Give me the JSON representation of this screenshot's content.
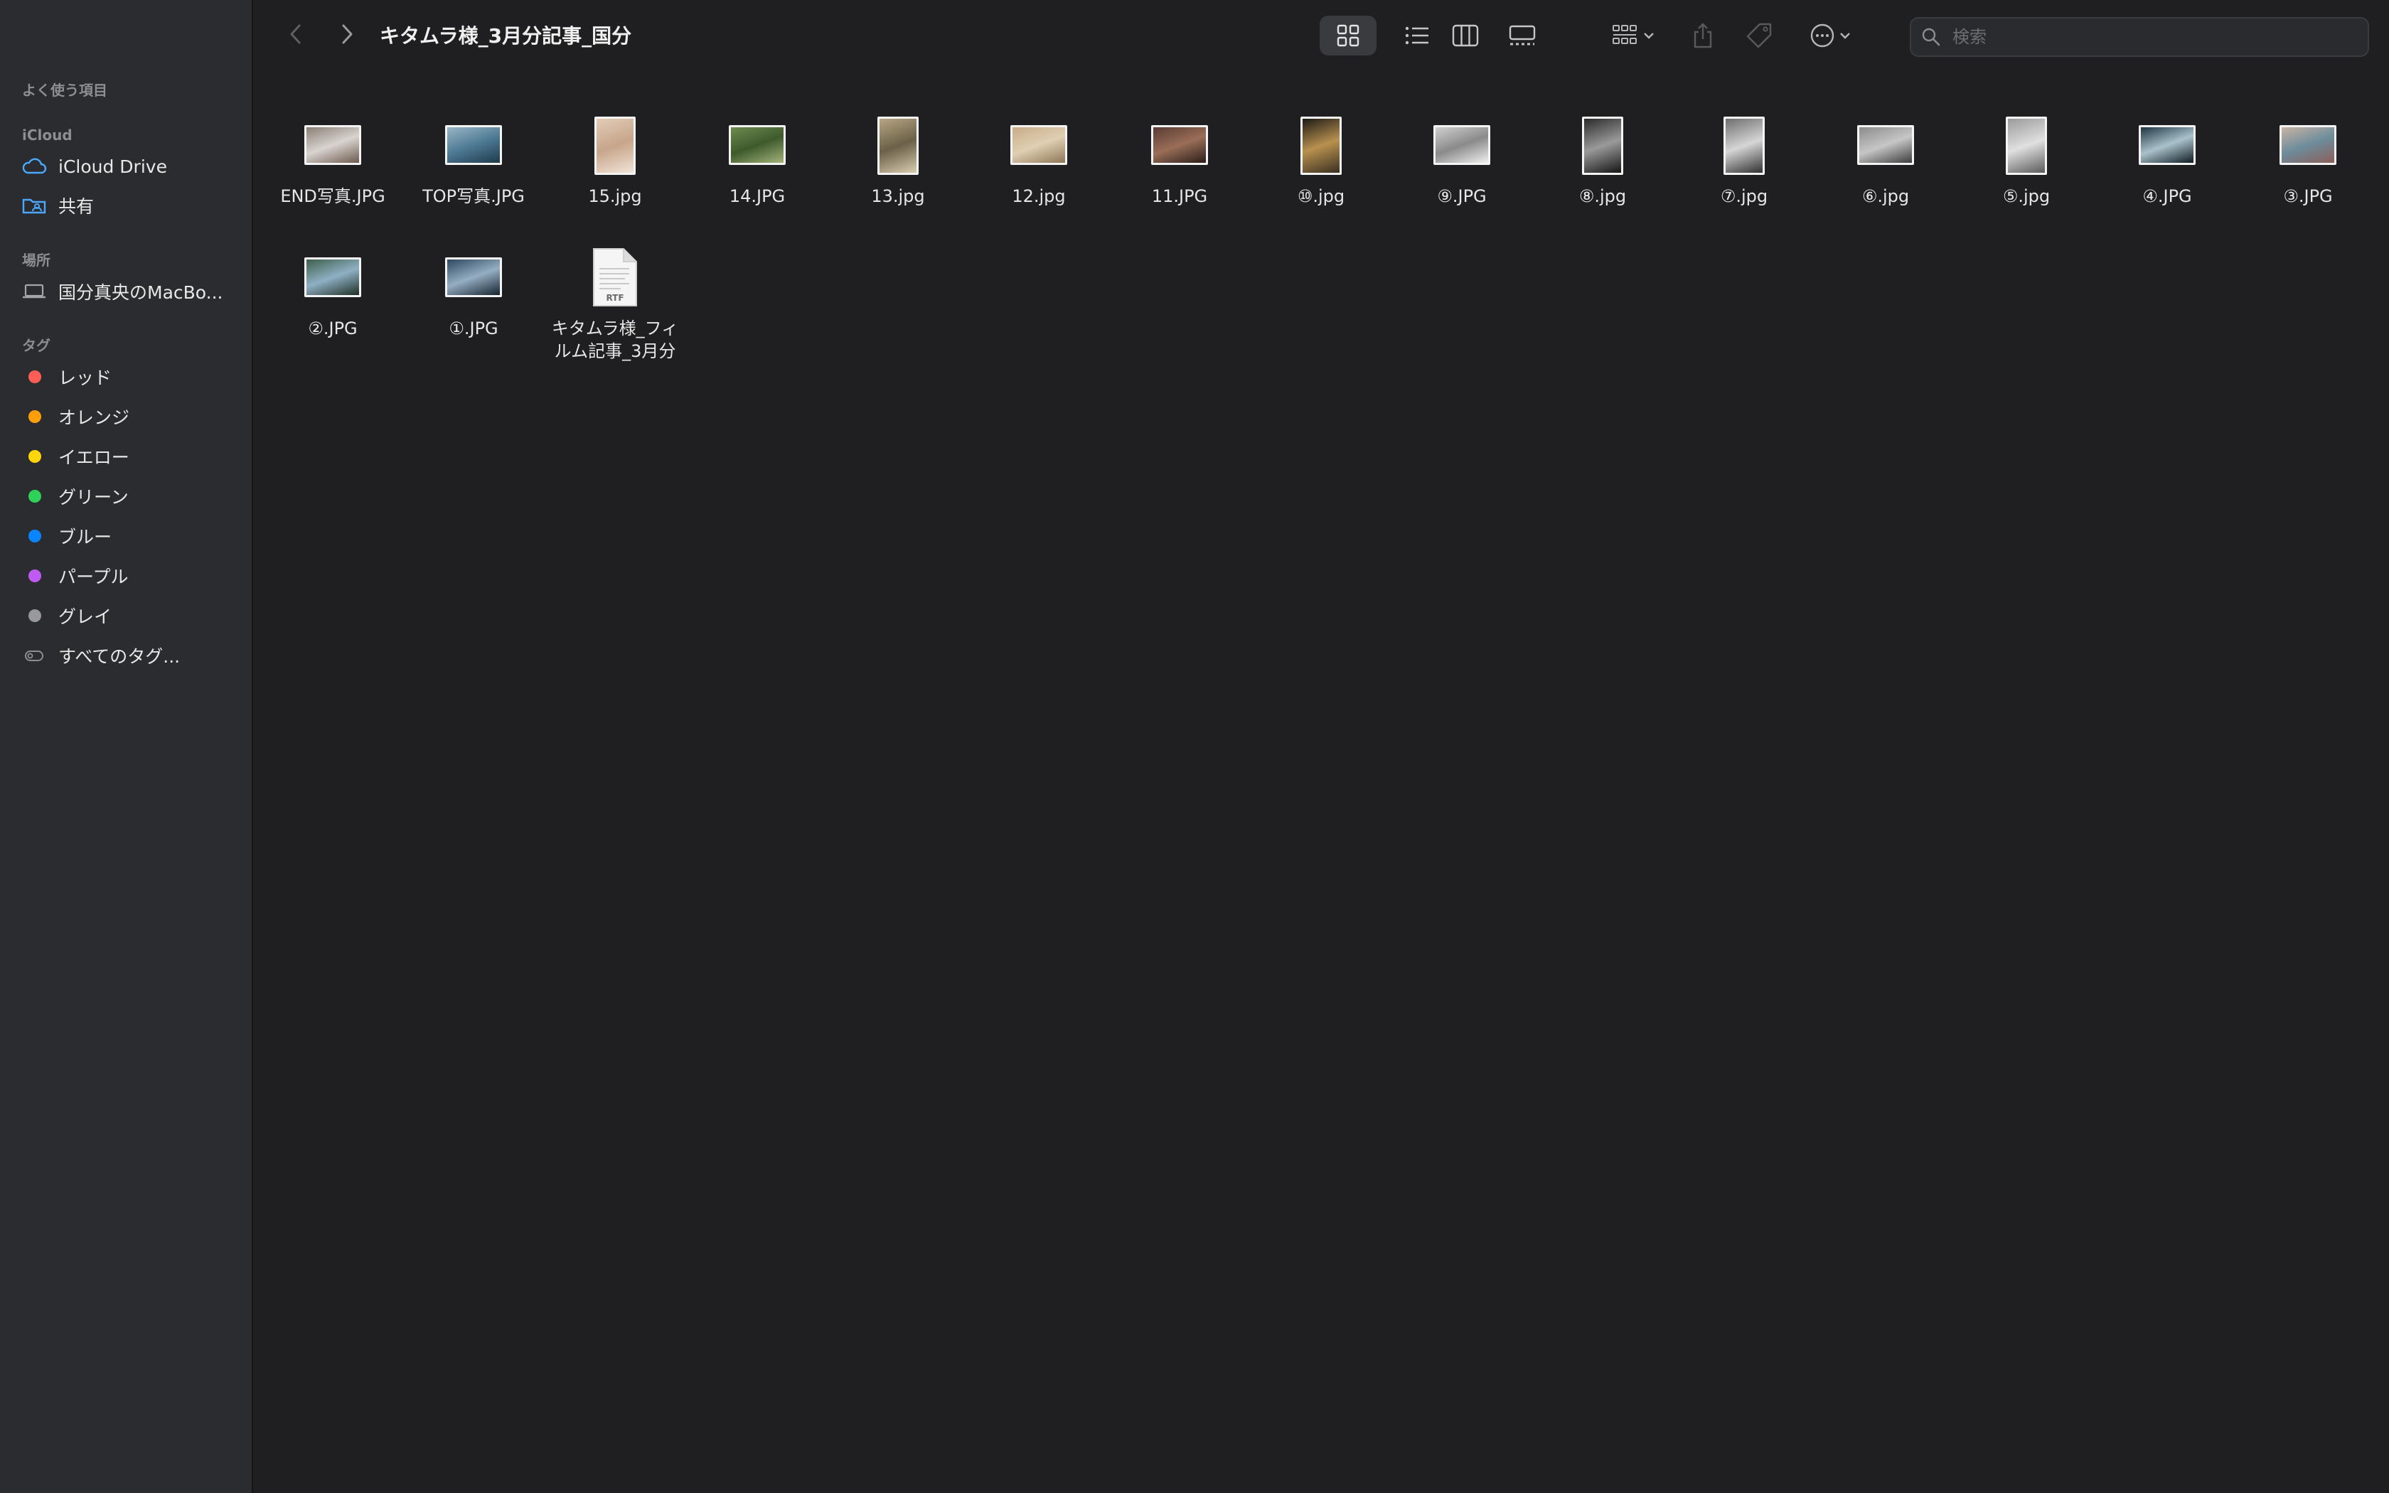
{
  "window": {
    "title": "キタムラ様_3月分記事_国分"
  },
  "sidebar": {
    "favorites_header": "よく使う項目",
    "icloud_header": "iCloud",
    "icloud_items": [
      {
        "label": "iCloud Drive",
        "icon": "cloud-icon"
      },
      {
        "label": "共有",
        "icon": "shared-folder-icon"
      }
    ],
    "locations_header": "場所",
    "location_items": [
      {
        "label": "国分真央のMacBo...",
        "icon": "laptop-icon"
      }
    ],
    "tags_header": "タグ",
    "tags": [
      {
        "label": "レッド",
        "color": "#ff5e57"
      },
      {
        "label": "オレンジ",
        "color": "#fe9f0a"
      },
      {
        "label": "イエロー",
        "color": "#ffd60a"
      },
      {
        "label": "グリーン",
        "color": "#30d158"
      },
      {
        "label": "ブルー",
        "color": "#0a84ff"
      },
      {
        "label": "パープル",
        "color": "#bf5af2"
      },
      {
        "label": "グレイ",
        "color": "#98989d"
      }
    ],
    "all_tags_label": "すべてのタグ..."
  },
  "toolbar": {
    "back_icon": "chevron-left-icon",
    "forward_icon": "chevron-right-icon",
    "view_modes": [
      "icon-view",
      "list-view",
      "column-view",
      "gallery-view"
    ],
    "active_view": "icon-view",
    "search_placeholder": "検索"
  },
  "files": [
    {
      "name": "END写真.JPG",
      "orient": "land",
      "colors": [
        "#8a7f77",
        "#d9d4cf",
        "#6c5a4f"
      ]
    },
    {
      "name": "TOP写真.JPG",
      "orient": "land",
      "colors": [
        "#9ab6c6",
        "#4d7a94",
        "#203a4c"
      ]
    },
    {
      "name": "15.jpg",
      "orient": "port",
      "colors": [
        "#e2cdb9",
        "#c7a58a",
        "#f1e4d8"
      ]
    },
    {
      "name": "14.JPG",
      "orient": "land",
      "colors": [
        "#6f8b4f",
        "#3e5a2c",
        "#a4b47a"
      ]
    },
    {
      "name": "13.jpg",
      "orient": "port",
      "colors": [
        "#b7a684",
        "#6b6048",
        "#d8cdb0"
      ]
    },
    {
      "name": "12.jpg",
      "orient": "land",
      "colors": [
        "#c7ac86",
        "#e0cfb3",
        "#8e7657"
      ]
    },
    {
      "name": "11.JPG",
      "orient": "land",
      "colors": [
        "#5a3c33",
        "#9a6e58",
        "#2a1d18"
      ]
    },
    {
      "name": "⑩.jpg",
      "orient": "port",
      "colors": [
        "#1d1a16",
        "#b8914f",
        "#3a2f22"
      ]
    },
    {
      "name": "⑨.JPG",
      "orient": "land",
      "colors": [
        "#d0d0d0",
        "#8a8a8a",
        "#f0f0f0"
      ]
    },
    {
      "name": "⑧.jpg",
      "orient": "port",
      "colors": [
        "#2b2b2b",
        "#9a9a9a",
        "#141414"
      ]
    },
    {
      "name": "⑦.jpg",
      "orient": "port",
      "colors": [
        "#6e6e6e",
        "#d6d6d6",
        "#303030"
      ]
    },
    {
      "name": "⑥.jpg",
      "orient": "land",
      "colors": [
        "#8c8c8c",
        "#c6c6c6",
        "#3c3c3c"
      ]
    },
    {
      "name": "⑤.jpg",
      "orient": "port",
      "colors": [
        "#9a9a9a",
        "#e0e0e0",
        "#5a5a5a"
      ]
    },
    {
      "name": "④.JPG",
      "orient": "land",
      "colors": [
        "#1f3541",
        "#a9c2cc",
        "#0e1a20"
      ]
    },
    {
      "name": "③.JPG",
      "orient": "land",
      "colors": [
        "#c9b4a4",
        "#6d8c9c",
        "#8b5e58"
      ]
    },
    {
      "name": "②.JPG",
      "orient": "land",
      "colors": [
        "#3d5f4a",
        "#8fb0c4",
        "#1f2e25"
      ]
    },
    {
      "name": "①.JPG",
      "orient": "land",
      "colors": [
        "#2c4860",
        "#95aec2",
        "#14222e"
      ]
    },
    {
      "name": "キタムラ様_フィルム記事_3月分",
      "orient": "rtf",
      "badge": "RTF",
      "colors": []
    }
  ]
}
